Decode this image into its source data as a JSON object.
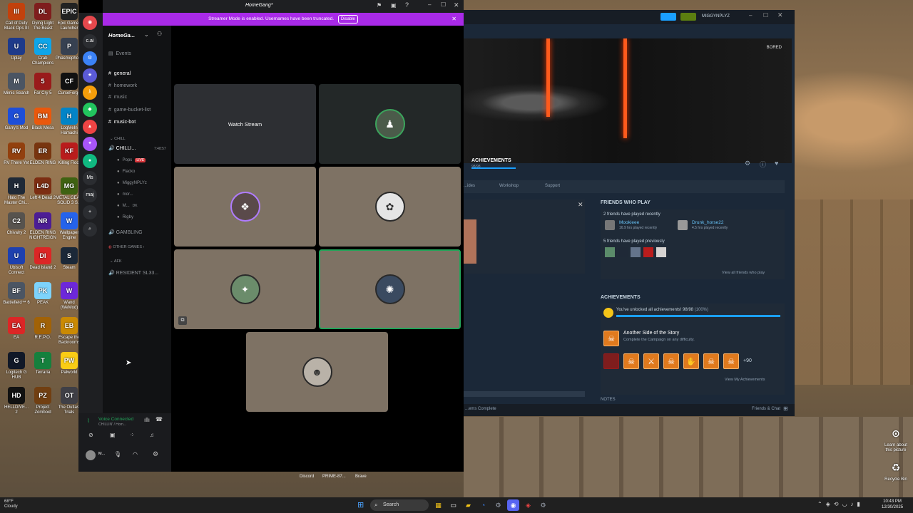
{
  "desktop": {
    "icons": [
      {
        "label": "Call of Duty Black Ops III",
        "color": "#c2410c",
        "glyph": "III"
      },
      {
        "label": "Dying Light The Beast",
        "color": "#7f1d1d",
        "glyph": "DL"
      },
      {
        "label": "Epic Games Launcher",
        "color": "#222222",
        "glyph": "EPIC"
      },
      {
        "label": "Uplay",
        "color": "#1e3a8a",
        "glyph": "U"
      },
      {
        "label": "Crab Champions",
        "color": "#0ea5e9",
        "glyph": "CC"
      },
      {
        "label": "Phasmophobia",
        "color": "#374151",
        "glyph": "P"
      },
      {
        "label": "Mimic Search",
        "color": "#4b5563",
        "glyph": "M"
      },
      {
        "label": "Far Cry 5",
        "color": "#991b1b",
        "glyph": "5"
      },
      {
        "label": "CurseForge",
        "color": "#111111",
        "glyph": "CF"
      },
      {
        "label": "Garry's Mod",
        "color": "#1d4ed8",
        "glyph": "G"
      },
      {
        "label": "Black Mesa",
        "color": "#ea580c",
        "glyph": "BM"
      },
      {
        "label": "LogMeIn Hamachi",
        "color": "#0284c7",
        "glyph": "H"
      },
      {
        "label": "RV There Yet",
        "color": "#92400e",
        "glyph": "RV"
      },
      {
        "label": "ELDEN RING",
        "color": "#78350f",
        "glyph": "ER"
      },
      {
        "label": "Killing Floor",
        "color": "#b91c1c",
        "glyph": "KF"
      },
      {
        "label": "Halo The Master Chi...",
        "color": "#1f2937",
        "glyph": "H"
      },
      {
        "label": "Left 4 Dead 2",
        "color": "#7c2d12",
        "glyph": "L4D"
      },
      {
        "label": "METAL GEAR SOLID 3 S...",
        "color": "#3f6212",
        "glyph": "MG"
      },
      {
        "label": "Chivalry 2",
        "color": "#57534e",
        "glyph": "C2"
      },
      {
        "label": "ELDEN RING NIGHTREIGN",
        "color": "#4c1d95",
        "glyph": "NR"
      },
      {
        "label": "Wallpaper Engine",
        "color": "#2563eb",
        "glyph": "W"
      },
      {
        "label": "Ubisoft Connect",
        "color": "#1e40af",
        "glyph": "U"
      },
      {
        "label": "Dead Island 2",
        "color": "#dc2626",
        "glyph": "DI"
      },
      {
        "label": "Steam",
        "color": "#1b2838",
        "glyph": "S"
      },
      {
        "label": "Battlefield™ 6",
        "color": "#4b5563",
        "glyph": "BF"
      },
      {
        "label": "PEAK",
        "color": "#7dd3fc",
        "glyph": "PK"
      },
      {
        "label": "Wand (WeMod)",
        "color": "#6d28d9",
        "glyph": "W"
      },
      {
        "label": "EA",
        "color": "#dc2626",
        "glyph": "EA"
      },
      {
        "label": "R.E.P.O.",
        "color": "#a16207",
        "glyph": "R"
      },
      {
        "label": "Escape the Backrooms",
        "color": "#ca8a04",
        "glyph": "EB"
      },
      {
        "label": "Logitech G HUB",
        "color": "#111827",
        "glyph": "G"
      },
      {
        "label": "Terraria",
        "color": "#15803d",
        "glyph": "T"
      },
      {
        "label": "Palworld",
        "color": "#facc15",
        "glyph": "PW"
      },
      {
        "label": "HELLDIVE... 2",
        "color": "#111111",
        "glyph": "HD"
      },
      {
        "label": "Project Zomboid",
        "color": "#713f12",
        "glyph": "PZ"
      },
      {
        "label": "The Outlast Trials",
        "color": "#3f3f46",
        "glyph": "OT"
      }
    ],
    "right_icons": [
      {
        "label": "Learn about this picture",
        "glyph": "⊙"
      },
      {
        "label": "Recycle Bin",
        "glyph": "♻"
      }
    ]
  },
  "taskbar": {
    "weather_temp": "68°F",
    "weather_desc": "Cloudy",
    "search_placeholder": "Search",
    "time": "10:43 PM",
    "date": "12/30/2025",
    "hover_labels": [
      "Discord",
      "PRIME-87...",
      "Brave"
    ]
  },
  "discord": {
    "title": "HomeGang*",
    "banner_text": "Streamer Mode is enabled. Usernames have been truncated.",
    "banner_button": "Disable",
    "server_name": "HomeGa...",
    "events_label": "Events",
    "channels": [
      {
        "name": "general",
        "bright": true
      },
      {
        "name": "homework",
        "bright": false
      },
      {
        "name": "music",
        "bright": false
      },
      {
        "name": "game-bucket-list",
        "bright": false
      },
      {
        "name": "music-bot",
        "bright": true
      }
    ],
    "category_chill": "CHILL",
    "voice_channel": "CHILLI...",
    "voice_time": "7:48:57",
    "voice_users": [
      {
        "name": "Pops",
        "badge": "LIVE"
      },
      {
        "name": "Flacko",
        "badge": ""
      },
      {
        "name": "MiggyNPLYz",
        "badge": ""
      },
      {
        "name": "mor...",
        "badge": ""
      },
      {
        "name": "M...",
        "badge": "DK"
      },
      {
        "name": "Rigby",
        "badge": ""
      }
    ],
    "gambling_channel": "GAMBLING",
    "category_other": "OTHER GAMES",
    "category_afk": "AFK",
    "afk_channel": "RESIDENT SL33...",
    "voice_status": "Voice Connected",
    "voice_status_sub": "CHILLIN' / Hom...",
    "user_short": "M...",
    "watch_stream": "Watch Stream",
    "servers": [
      {
        "glyph": "c.ai",
        "color": "#2b2d31"
      },
      {
        "glyph": "⚙",
        "color": "#3b82f6"
      },
      {
        "glyph": "★",
        "color": "#5b5bd6"
      },
      {
        "glyph": "ƛ",
        "color": "#f59e0b"
      },
      {
        "glyph": "◆",
        "color": "#22c55e"
      },
      {
        "glyph": "▲",
        "color": "#ef4444"
      },
      {
        "glyph": "✦",
        "color": "#a855f7"
      },
      {
        "glyph": "●",
        "color": "#10b981"
      },
      {
        "glyph": "Ms",
        "color": "#2b2d31"
      },
      {
        "glyph": "maj",
        "color": "#2b2d31"
      },
      {
        "glyph": "+",
        "color": "#2b2d31"
      },
      {
        "glyph": "⌕",
        "color": "#2b2d31"
      }
    ]
  },
  "steam": {
    "user": "MIGGYNPLYZ",
    "bored_tag": "BORED",
    "achievements_header": "ACHIEVEMENTS",
    "achievements_count": "98/98",
    "tabs": [
      "...ides",
      "Workshop",
      "Support"
    ],
    "friends_who_play": "FRIENDS WHO PLAY",
    "friends_recent_count": "2 friends have played recently",
    "friend1_name": "Mookieee",
    "friend1_time": "16.9 hrs played recently",
    "friend2_name": "Drunk_horse22",
    "friend2_time": "4.5 hrs played recently",
    "friends_previous": "5 friends have played previously",
    "view_all_friends": "View all friends who play",
    "achievements_section": "ACHIEVEMENTS",
    "unlocked_text": "You've unlocked all achievements! 98/98",
    "unlocked_pct": "(100%)",
    "unlocked_fraction": 1.0,
    "ach_title": "Another Side of the Story",
    "ach_desc": "Complete the Campaign on any difficulty.",
    "more_count": "+90",
    "view_my_ach": "View My Achievements",
    "notes_label": "NOTES",
    "items_complete": "...ems Complete",
    "friends_chat": "Friends & Chat"
  }
}
